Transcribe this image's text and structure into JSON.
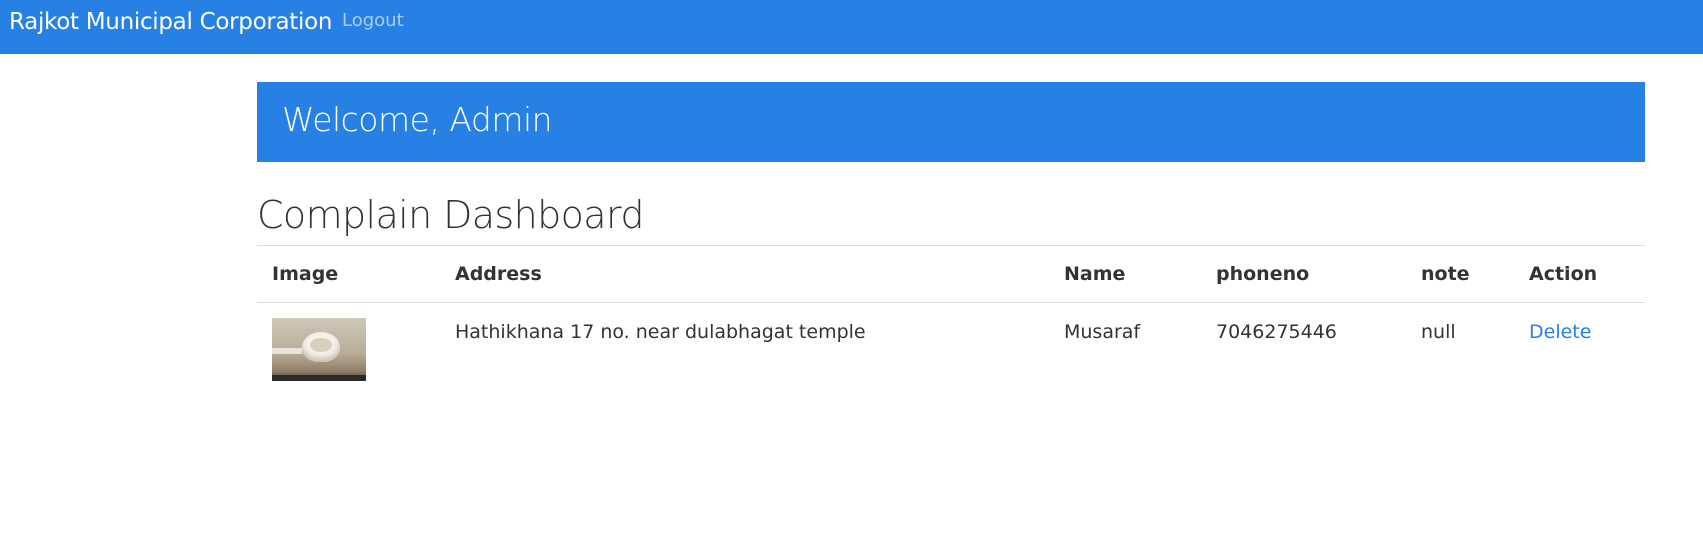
{
  "navbar": {
    "brand": "Rajkot Municipal Corporation",
    "logout_label": "Logout"
  },
  "jumbotron": {
    "welcome": "Welcome, Admin"
  },
  "page": {
    "title": "Complain Dashboard"
  },
  "table": {
    "headers": [
      "Image",
      "Address",
      "Name",
      "phoneno",
      "note",
      "Action"
    ],
    "rows": [
      {
        "image": "toilet-photo-thumbnail",
        "address": "Hathikhana 17 no. near dulabhagat temple",
        "name": "Musaraf",
        "phoneno": "7046275446",
        "note": "null",
        "action": "Delete"
      }
    ]
  },
  "colors": {
    "primary": "#2780e3",
    "nav_link": "#a9cdf4",
    "text": "#333333",
    "rule": "#dddddd"
  }
}
